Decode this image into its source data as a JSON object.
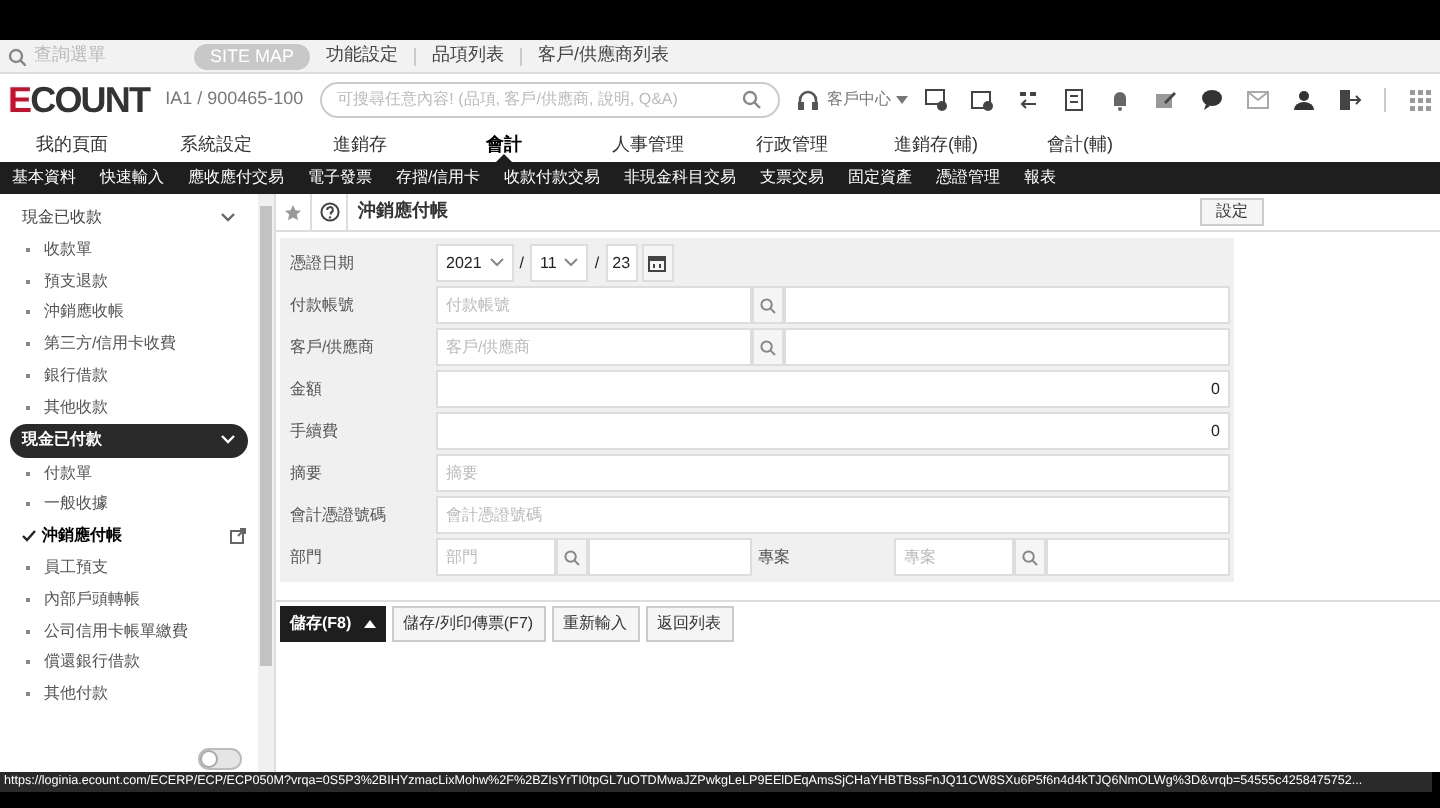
{
  "quick_bar": {
    "menu_search_placeholder": "查詢選單",
    "links": [
      {
        "label": "SITE MAP",
        "kind": "pill"
      },
      {
        "label": "功能設定",
        "kind": "link"
      },
      {
        "label": "品項列表",
        "kind": "link"
      },
      {
        "label": "客戶/供應商列表",
        "kind": "link"
      }
    ]
  },
  "header": {
    "logo": "ECOUNT",
    "company": "IA1 / 900465-100",
    "search_placeholder": "可搜尋任意內容! (品項, 客戶/供應商, 說明, Q&A)",
    "support": "客戶中心"
  },
  "main_nav": [
    {
      "label": "我的頁面",
      "selected": false
    },
    {
      "label": "系統設定",
      "selected": false
    },
    {
      "label": "進銷存",
      "selected": false
    },
    {
      "label": "會計",
      "selected": true
    },
    {
      "label": "人事管理",
      "selected": false
    },
    {
      "label": "行政管理",
      "selected": false
    },
    {
      "label": "進銷存(輔)",
      "selected": false
    },
    {
      "label": "會計(輔)",
      "selected": false
    }
  ],
  "sub_nav": [
    "基本資料",
    "快速輸入",
    "應收應付交易",
    "電子發票",
    "存摺/信用卡",
    "收款付款交易",
    "非現金科目交易",
    "支票交易",
    "固定資產",
    "憑證管理",
    "報表"
  ],
  "sidebar": [
    {
      "label": "現金已收款",
      "selected": false,
      "expanded": true,
      "children": [
        {
          "label": "收款單",
          "selected": false
        },
        {
          "label": "預支退款",
          "selected": false
        },
        {
          "label": "沖銷應收帳",
          "selected": false
        },
        {
          "label": "第三方/信用卡收費",
          "selected": false
        },
        {
          "label": "銀行借款",
          "selected": false
        },
        {
          "label": "其他收款",
          "selected": false
        }
      ]
    },
    {
      "label": "現金已付款",
      "selected": true,
      "expanded": true,
      "children": [
        {
          "label": "付款單",
          "selected": false
        },
        {
          "label": "一般收據",
          "selected": false
        },
        {
          "label": "沖銷應付帳",
          "selected": true
        },
        {
          "label": "員工預支",
          "selected": false
        },
        {
          "label": "內部戶頭轉帳",
          "selected": false
        },
        {
          "label": "公司信用卡帳單繳費",
          "selected": false
        },
        {
          "label": "償還銀行借款",
          "selected": false
        },
        {
          "label": "其他付款",
          "selected": false
        }
      ]
    }
  ],
  "sidebar_toggle": {
    "on": false
  },
  "page": {
    "title": "沖銷應付帳",
    "settings_button": "設定"
  },
  "form": [
    {
      "kind": "date",
      "label": "憑證日期",
      "year": "2021",
      "separator": "/",
      "month": "11",
      "day": "23"
    },
    {
      "kind": "lookup",
      "label": "付款帳號",
      "placeholder": "付款帳號"
    },
    {
      "kind": "lookup",
      "label": "客戶/供應商",
      "placeholder": "客戶/供應商"
    },
    {
      "kind": "number",
      "label": "金額",
      "value": "0"
    },
    {
      "kind": "number",
      "label": "手續費",
      "value": "0"
    },
    {
      "kind": "text",
      "label": "摘要",
      "placeholder": "摘要"
    },
    {
      "kind": "text",
      "label": "會計憑證號碼",
      "placeholder": "會計憑證號碼"
    },
    {
      "kind": "pair",
      "label": "部門",
      "placeholder": "部門",
      "label2": "專案",
      "placeholder2": "專案"
    }
  ],
  "actions": [
    {
      "label": "儲存(F8)",
      "kind": "primary"
    },
    {
      "label": "儲存/列印傳票(F7)",
      "kind": "normal"
    },
    {
      "label": "重新輸入",
      "kind": "normal"
    },
    {
      "label": "返回列表",
      "kind": "normal"
    }
  ],
  "status_url": "https://loginia.ecount.com/ECERP/ECP/ECP050M?vrqa=0S5P3%2BIHYzmacLixMohw%2F%2BZIsYrTI0tpGL7uOTDMwaJZPwkgLeLP9EElDEqAmsSjCHaYHBTBssFnJQ11CW8SXu6P5f6n4d4kTJQ6NmOLWg%3D&vrqb=54555c4258475752..."
}
